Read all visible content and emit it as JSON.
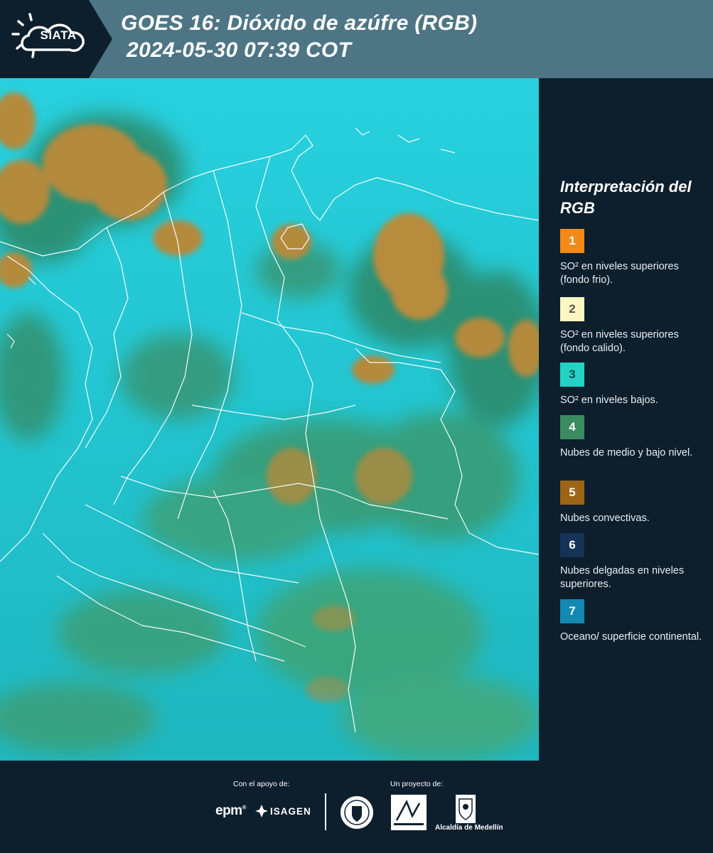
{
  "header": {
    "logo_text": "SIATA",
    "title_line1": "GOES 16: Dióxido de azúfre (RGB)",
    "title_line2": "2024-05-30 07:39 COT"
  },
  "colors": {
    "header_bg": "#4d7584",
    "panel_bg": "#0d1f2d",
    "map_base": "#1ec5cf",
    "cloud_orange": "#b58a3a",
    "cloud_green": "#3a8f6a"
  },
  "legend": {
    "title": "Interpretación del RGB",
    "items": [
      {
        "number": "1",
        "color": "#f28a17",
        "text_color": "#ffffff",
        "label": "SO² en niveles superiores (fondo frio)."
      },
      {
        "number": "2",
        "color": "#fdf6c0",
        "text_color": "#555555",
        "label": "SO² en niveles superiores (fondo calido)."
      },
      {
        "number": "3",
        "color": "#22d3c5",
        "text_color": "#1c4a4a",
        "label": "SO² en niveles bajos."
      },
      {
        "number": "4",
        "color": "#3a8c60",
        "text_color": "#ffffff",
        "label": "Nubes de medio y bajo nivel."
      },
      {
        "number": "5",
        "color": "#9c6414",
        "text_color": "#ffffff",
        "label": "Nubes convectivas."
      },
      {
        "number": "6",
        "color": "#153257",
        "text_color": "#ffffff",
        "label": "Nubes delgadas en niveles superiores."
      },
      {
        "number": "7",
        "color": "#1389b2",
        "text_color": "#ffffff",
        "label": "Oceano/ superficie continental."
      }
    ]
  },
  "footer": {
    "support_label": "Con el apoyo de:",
    "project_label": "Un proyecto de:",
    "epm": "epm",
    "isagen": "ISAGEN",
    "alcaldia": "Alcaldía de Medellín"
  }
}
